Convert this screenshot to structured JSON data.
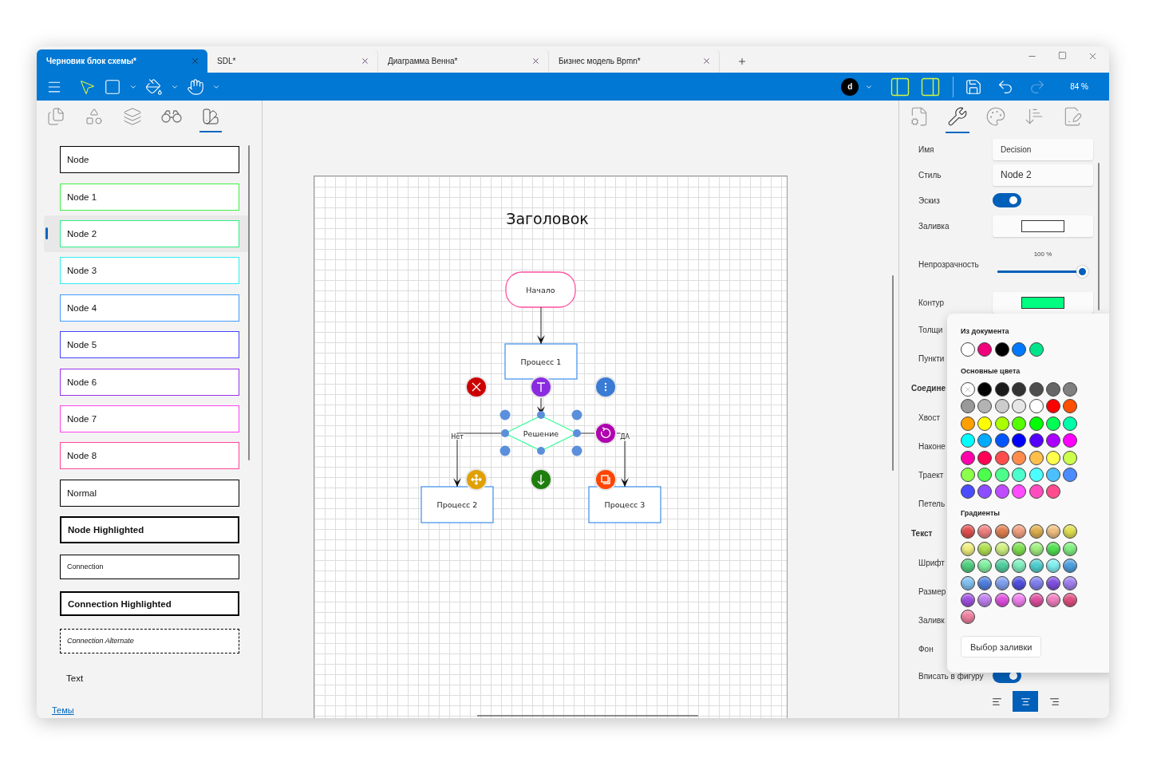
{
  "tabs": [
    {
      "label": "Черновик блок схемы*",
      "selected": true
    },
    {
      "label": "SDL*",
      "selected": false
    },
    {
      "label": "Диаграмма Венна*",
      "selected": false
    },
    {
      "label": "Бизнес модель Bpmn*",
      "selected": false
    }
  ],
  "toolbar": {
    "tools": [
      {
        "kind": "pointer",
        "selected": true
      },
      {
        "kind": "shape",
        "selected": false
      },
      {
        "kind": "fill",
        "selected": false
      },
      {
        "kind": "hand",
        "selected": false
      }
    ],
    "avatar": "d",
    "undo": {
      "disabled": false
    },
    "redo": {
      "disabled": true
    },
    "zoom": "84 %"
  },
  "left_panel": {
    "tabs": [
      {
        "kind": "pages",
        "selected": false
      },
      {
        "kind": "shapes",
        "selected": false
      },
      {
        "kind": "layers",
        "selected": false
      },
      {
        "kind": "search",
        "selected": false
      },
      {
        "kind": "styles",
        "selected": true
      }
    ],
    "styles": [
      {
        "kind": "node",
        "label": "Node",
        "color": "#000000",
        "selected": false
      },
      {
        "kind": "node",
        "label": "Node 1",
        "color": "#44ee44",
        "selected": false
      },
      {
        "kind": "node",
        "label": "Node 2",
        "color": "#33ee88",
        "selected": true
      },
      {
        "kind": "node",
        "label": "Node 3",
        "color": "#33eeee",
        "selected": false
      },
      {
        "kind": "node",
        "label": "Node 4",
        "color": "#4499ff",
        "selected": false
      },
      {
        "kind": "node",
        "label": "Node 5",
        "color": "#4444ff",
        "selected": false
      },
      {
        "kind": "node",
        "label": "Node 6",
        "color": "#9933ee",
        "selected": false
      },
      {
        "kind": "node",
        "label": "Node 7",
        "color": "#ff44ee",
        "selected": false
      },
      {
        "kind": "node",
        "label": "Node 8",
        "color": "#ff4499",
        "selected": false
      },
      {
        "kind": "node",
        "label": "Normal",
        "color": "#000000",
        "selected": false
      },
      {
        "kind": "highlighted",
        "label": "Node Highlighted",
        "color": "#000000",
        "selected": false
      },
      {
        "kind": "connection",
        "label": "Connection",
        "color": "#000000",
        "selected": false
      },
      {
        "kind": "connection_highlighted",
        "label": "Connection Highlighted",
        "color": "#000000",
        "selected": false
      },
      {
        "kind": "connection_alternate",
        "label": "Connection Alternate",
        "color": "#000000",
        "selected": false
      },
      {
        "kind": "text",
        "label": "Text",
        "selected": false
      }
    ],
    "themes_link": "Темы"
  },
  "diagram": {
    "title": "Заголовок",
    "nodes": [
      {
        "kind": "cloud",
        "label": "Начало"
      },
      {
        "kind": "process",
        "label": "Процесс 1"
      },
      {
        "kind": "decision",
        "label": "Решение",
        "selected": true
      },
      {
        "kind": "process",
        "label": "Процесс 2"
      },
      {
        "kind": "process",
        "label": "Процесс 3"
      }
    ],
    "edge_labels": [
      "Нет",
      "ДА"
    ],
    "actions": [
      {
        "kind": "delete",
        "color": "#cc0000"
      },
      {
        "kind": "text",
        "color": "#8a2be2"
      },
      {
        "kind": "more",
        "color": "#3a7bd5"
      },
      {
        "kind": "rotate",
        "color": "#b000b0"
      },
      {
        "kind": "move",
        "color": "#e0a000"
      },
      {
        "kind": "down",
        "color": "#1e7e0e"
      },
      {
        "kind": "copy",
        "color": "#ff4500"
      }
    ]
  },
  "right_panel": {
    "tabs": [
      {
        "kind": "document",
        "selected": false
      },
      {
        "kind": "tools",
        "selected": true
      },
      {
        "kind": "palette",
        "selected": false
      },
      {
        "kind": "sort",
        "selected": false
      },
      {
        "kind": "notes",
        "selected": false
      }
    ],
    "properties": [
      {
        "kind": "field",
        "label": "Имя",
        "value": "Decision"
      },
      {
        "kind": "field",
        "label": "Стиль",
        "value": "Node 2"
      },
      {
        "kind": "toggle",
        "label": "Эскиз",
        "on": true
      },
      {
        "kind": "color",
        "label": "Заливка",
        "color": "#ffffff"
      },
      {
        "kind": "slider",
        "label": "Непрозрачность",
        "reading": "100 %",
        "level": 1
      },
      {
        "kind": "color",
        "label": "Контур",
        "color": "#00ff80"
      },
      {
        "kind": "label",
        "label": "Толщи"
      },
      {
        "kind": "label",
        "label": "Пункти"
      },
      {
        "kind": "section",
        "label": "Соедине"
      },
      {
        "kind": "label",
        "label": "Хвост"
      },
      {
        "kind": "label",
        "label": "Наконе"
      },
      {
        "kind": "label",
        "label": "Траект"
      },
      {
        "kind": "label",
        "label": "Петель"
      },
      {
        "kind": "section",
        "label": "Текст"
      },
      {
        "kind": "label",
        "label": "Шрифт"
      },
      {
        "kind": "label",
        "label": "Размер"
      },
      {
        "kind": "label",
        "label": "Заливк"
      },
      {
        "kind": "label",
        "label": "Фон"
      },
      {
        "kind": "toggle",
        "label": "Вписать в фигуру",
        "on": true
      }
    ],
    "align": [
      {
        "kind": "left",
        "selected": false
      },
      {
        "kind": "center",
        "selected": true
      },
      {
        "kind": "right",
        "selected": false
      }
    ]
  },
  "color_popup": {
    "document_heading": "Из документа",
    "document_colors": [
      {
        "color": "#ffffff"
      },
      {
        "color": "#f0007a"
      },
      {
        "color": "#000000"
      },
      {
        "color": "#0078ff"
      },
      {
        "color": "#00e58a"
      }
    ],
    "basic_heading": "Основные цвета",
    "basic_colors": [
      {
        "kind": "none"
      },
      {
        "kind": "solid",
        "color": "#000000"
      },
      {
        "kind": "solid",
        "color": "#1a1a1a"
      },
      {
        "kind": "solid",
        "color": "#333333"
      },
      {
        "kind": "solid",
        "color": "#4d4d4d"
      },
      {
        "kind": "solid",
        "color": "#666666"
      },
      {
        "kind": "solid",
        "color": "#808080"
      },
      {
        "kind": "solid",
        "color": "#999999"
      },
      {
        "kind": "solid",
        "color": "#b3b3b3"
      },
      {
        "kind": "solid",
        "color": "#cccccc"
      },
      {
        "kind": "solid",
        "color": "#e6e6e6"
      },
      {
        "kind": "solid",
        "color": "#ffffff"
      },
      {
        "kind": "solid",
        "color": "#ff0000"
      },
      {
        "kind": "solid",
        "color": "#ff5000"
      },
      {
        "kind": "solid",
        "color": "#ffa000"
      },
      {
        "kind": "solid",
        "color": "#ffff00"
      },
      {
        "kind": "solid",
        "color": "#aaff00"
      },
      {
        "kind": "solid",
        "color": "#55ff00"
      },
      {
        "kind": "solid",
        "color": "#00ff00"
      },
      {
        "kind": "solid",
        "color": "#00ff55"
      },
      {
        "kind": "solid",
        "color": "#00ffaa"
      },
      {
        "kind": "solid",
        "color": "#00ffff"
      },
      {
        "kind": "solid",
        "color": "#00aaff"
      },
      {
        "kind": "solid",
        "color": "#0055ff"
      },
      {
        "kind": "solid",
        "color": "#0000ff"
      },
      {
        "kind": "solid",
        "color": "#5500ff"
      },
      {
        "kind": "solid",
        "color": "#aa00ff"
      },
      {
        "kind": "solid",
        "color": "#ff00ff"
      },
      {
        "kind": "solid",
        "color": "#ff00aa"
      },
      {
        "kind": "solid",
        "color": "#ff0055"
      },
      {
        "kind": "solid",
        "color": "#ff4c4c"
      },
      {
        "kind": "solid",
        "color": "#ff8c4c"
      },
      {
        "kind": "solid",
        "color": "#ffbf4c"
      },
      {
        "kind": "solid",
        "color": "#ffff4c"
      },
      {
        "kind": "solid",
        "color": "#ccff4c"
      },
      {
        "kind": "solid",
        "color": "#8cff4c"
      },
      {
        "kind": "solid",
        "color": "#4cff4c"
      },
      {
        "kind": "solid",
        "color": "#4cff8c"
      },
      {
        "kind": "solid",
        "color": "#4cffcc"
      },
      {
        "kind": "solid",
        "color": "#4cffff"
      },
      {
        "kind": "solid",
        "color": "#4cbfff"
      },
      {
        "kind": "solid",
        "color": "#4c8cff"
      },
      {
        "kind": "solid",
        "color": "#4c4cff"
      },
      {
        "kind": "solid",
        "color": "#8c4cff"
      },
      {
        "kind": "solid",
        "color": "#bf4cff"
      },
      {
        "kind": "solid",
        "color": "#ff4cff"
      },
      {
        "kind": "solid",
        "color": "#ff4cbf"
      },
      {
        "kind": "solid",
        "color": "#ff4c8c"
      }
    ],
    "gradients_heading": "Градиенты",
    "gradients": [
      {
        "color": "#e05050"
      },
      {
        "color": "#f08080"
      },
      {
        "color": "#e08050"
      },
      {
        "color": "#f0a080"
      },
      {
        "color": "#e0b050"
      },
      {
        "color": "#f0c080"
      },
      {
        "color": "#e0e050"
      },
      {
        "color": "#f0f080"
      },
      {
        "color": "#b0e050"
      },
      {
        "color": "#d0f080"
      },
      {
        "color": "#80e050"
      },
      {
        "color": "#a0f080"
      },
      {
        "color": "#50e050"
      },
      {
        "color": "#80f080"
      },
      {
        "color": "#50d080"
      },
      {
        "color": "#80f0a0"
      },
      {
        "color": "#50d0a0"
      },
      {
        "color": "#80f0c0"
      },
      {
        "color": "#50d0d0"
      },
      {
        "color": "#80f0f0"
      },
      {
        "color": "#50a0e0"
      },
      {
        "color": "#80c0f0"
      },
      {
        "color": "#5080e0"
      },
      {
        "color": "#80a0f0"
      },
      {
        "color": "#5050e0"
      },
      {
        "color": "#8080f0"
      },
      {
        "color": "#8050e0"
      },
      {
        "color": "#a080f0"
      },
      {
        "color": "#a050e0"
      },
      {
        "color": "#c080f0"
      },
      {
        "color": "#e050e0"
      },
      {
        "color": "#f080f0"
      },
      {
        "color": "#e050a0"
      },
      {
        "color": "#f080c0"
      },
      {
        "color": "#e05080"
      },
      {
        "color": "#f080a0"
      }
    ],
    "pick_button": "Выбор заливки"
  }
}
